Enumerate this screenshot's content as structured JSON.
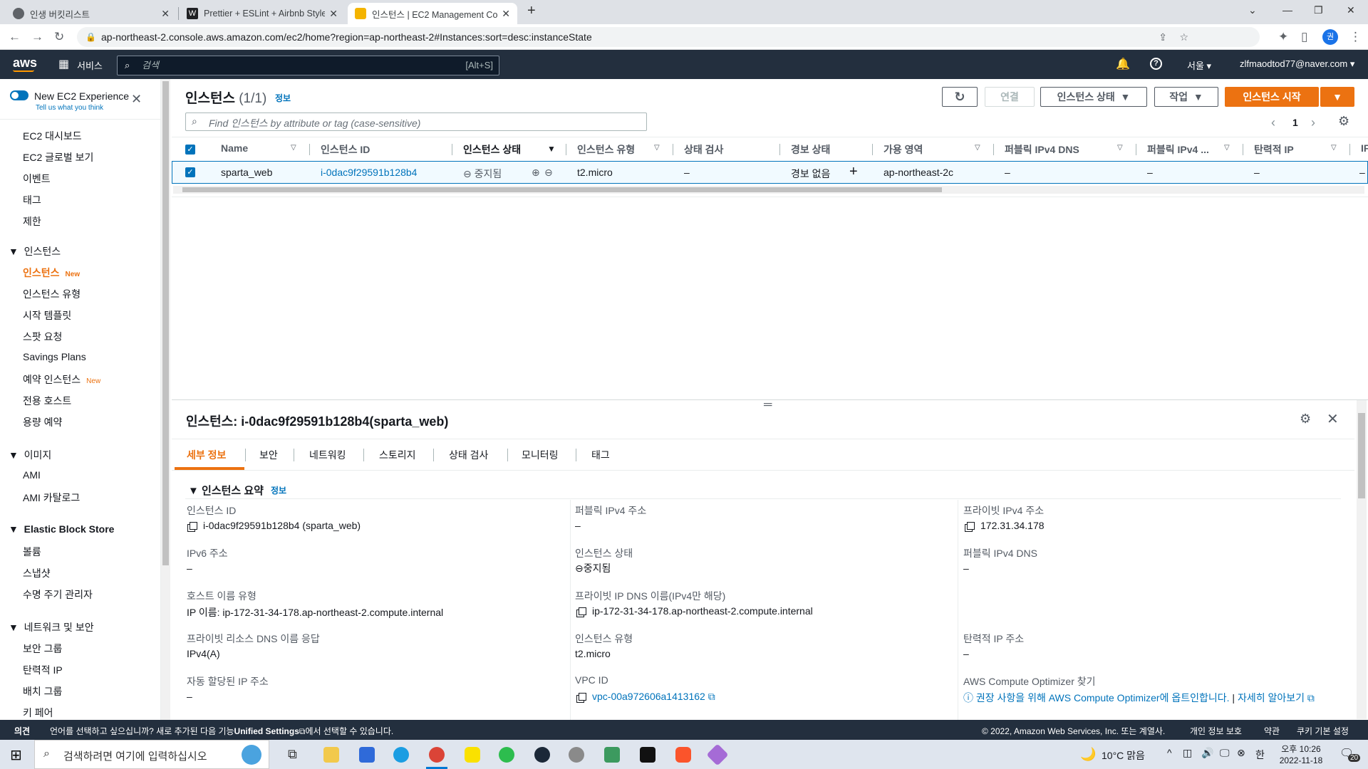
{
  "browser": {
    "tabs": [
      {
        "title": "인생 버킷리스트",
        "favicon_color": "#5f6368"
      },
      {
        "title": "Prettier + ESLint + Airbnb Style",
        "favicon_color": "#202124"
      },
      {
        "title": "인스턴스 | EC2 Management Co",
        "favicon_color": "#f4b400"
      }
    ],
    "url": "ap-northeast-2.console.aws.amazon.com/ec2/home?region=ap-northeast-2#Instances:sort=desc:instanceState",
    "profile_initial": "권"
  },
  "aws_header": {
    "logo": "aws",
    "services": "서비스",
    "search_placeholder": "검색",
    "search_shortcut": "[Alt+S]",
    "region": "서울",
    "account": "zlfmaodtod77@naver.com"
  },
  "sidebar": {
    "toggle_label": "New EC2 Experience",
    "toggle_sub": "Tell us what you think",
    "new_badge": "New",
    "items_top": [
      "EC2 대시보드",
      "EC2 글로벌 보기",
      "이벤트",
      "태그",
      "제한"
    ],
    "sections": [
      {
        "title": "인스턴스",
        "items": [
          "인스턴스",
          "인스턴스 유형",
          "시작 템플릿",
          "스팟 요청",
          "Savings Plans",
          "예약 인스턴스",
          "전용 호스트",
          "용량 예약"
        ]
      },
      {
        "title": "이미지",
        "items": [
          "AMI",
          "AMI 카탈로그"
        ]
      },
      {
        "title": "Elastic Block Store",
        "items": [
          "볼륨",
          "스냅샷",
          "수명 주기 관리자"
        ]
      },
      {
        "title": "네트워크 및 보안",
        "items": [
          "보안 그룹",
          "탄력적 IP",
          "배치 그룹",
          "키 페어"
        ]
      }
    ]
  },
  "instances_panel": {
    "title": "인스턴스",
    "count": "(1/1)",
    "info": "정보",
    "buttons": {
      "refresh": "↻",
      "connect": "연결",
      "state": "인스턴스 상태",
      "actions": "작업",
      "launch": "인스턴스 시작"
    },
    "filter_placeholder": "Find 인스턴스 by attribute or tag (case-sensitive)",
    "page": "1",
    "columns": [
      "Name",
      "인스턴스 ID",
      "인스턴스 상태",
      "인스턴스 유형",
      "상태 검사",
      "경보 상태",
      "가용 영역",
      "퍼블릭 IPv4 DNS",
      "퍼블릭 IPv4 ...",
      "탄력적 IP",
      "IF"
    ],
    "rows": [
      {
        "name": "sparta_web",
        "id": "i-0dac9f29591b128b4",
        "state": "중지됨",
        "type": "t2.micro",
        "check": "–",
        "alarm": "경보 없음",
        "az": "ap-northeast-2c",
        "dns": "–",
        "ipv4": "–",
        "eip": "–",
        "extra": "–"
      }
    ]
  },
  "details": {
    "title": "인스턴스: i-0dac9f29591b128b4(sparta_web)",
    "tabs": [
      "세부 정보",
      "보안",
      "네트워킹",
      "스토리지",
      "상태 검사",
      "모니터링",
      "태그"
    ],
    "summary_title": "인스턴스 요약",
    "summary_info": "정보",
    "col1": [
      {
        "label": "인스턴스 ID",
        "value": "i-0dac9f29591b128b4 (sparta_web)"
      },
      {
        "label": "IPv6 주소",
        "value": "–"
      },
      {
        "label": "호스트 이름 유형",
        "value": "IP 이름: ip-172-31-34-178.ap-northeast-2.compute.internal"
      },
      {
        "label": "프라이빗 리소스 DNS 이름 응답",
        "value": "IPv4(A)"
      },
      {
        "label": "자동 할당된 IP 주소",
        "value": "–"
      }
    ],
    "col2": [
      {
        "label": "퍼블릭 IPv4 주소",
        "value": "–"
      },
      {
        "label": "인스턴스 상태",
        "value": "중지됨"
      },
      {
        "label": "프라이빗 IP DNS 이름(IPv4만 해당)",
        "value": "ip-172-31-34-178.ap-northeast-2.compute.internal"
      },
      {
        "label": "인스턴스 유형",
        "value": "t2.micro"
      },
      {
        "label": "VPC ID",
        "value": "vpc-00a972606a1413162"
      }
    ],
    "col3": [
      {
        "label": "프라이빗 IPv4 주소",
        "value": "172.31.34.178"
      },
      {
        "label": "퍼블릭 IPv4 DNS",
        "value": "–"
      },
      {
        "label": "탄력적 IP 주소",
        "value": "–"
      },
      {
        "label": "AWS Compute Optimizer 찾기",
        "value": "권장 사항을 위해 AWS Compute Optimizer에 옵트인합니다.",
        "link2": "자세히 알아보기"
      }
    ]
  },
  "footer": {
    "feedback": "의견",
    "lang_pre": "언어를 선택하고 싶으십니까? 새로 추가된 다음 기능",
    "lang_link": "Unified Settings",
    "lang_post": "에서 선택할 수 있습니다.",
    "copyright": "© 2022, Amazon Web Services, Inc. 또는 계열사.",
    "privacy": "개인 정보 보호",
    "terms": "약관",
    "cookies": "쿠키 기본 설정"
  },
  "taskbar": {
    "search_placeholder": "검색하려면 여기에 입력하십시오",
    "weather": "10°C 맑음",
    "ime": "한",
    "time": "오후 10:26",
    "date": "2022-11-18",
    "notifications": "20"
  }
}
